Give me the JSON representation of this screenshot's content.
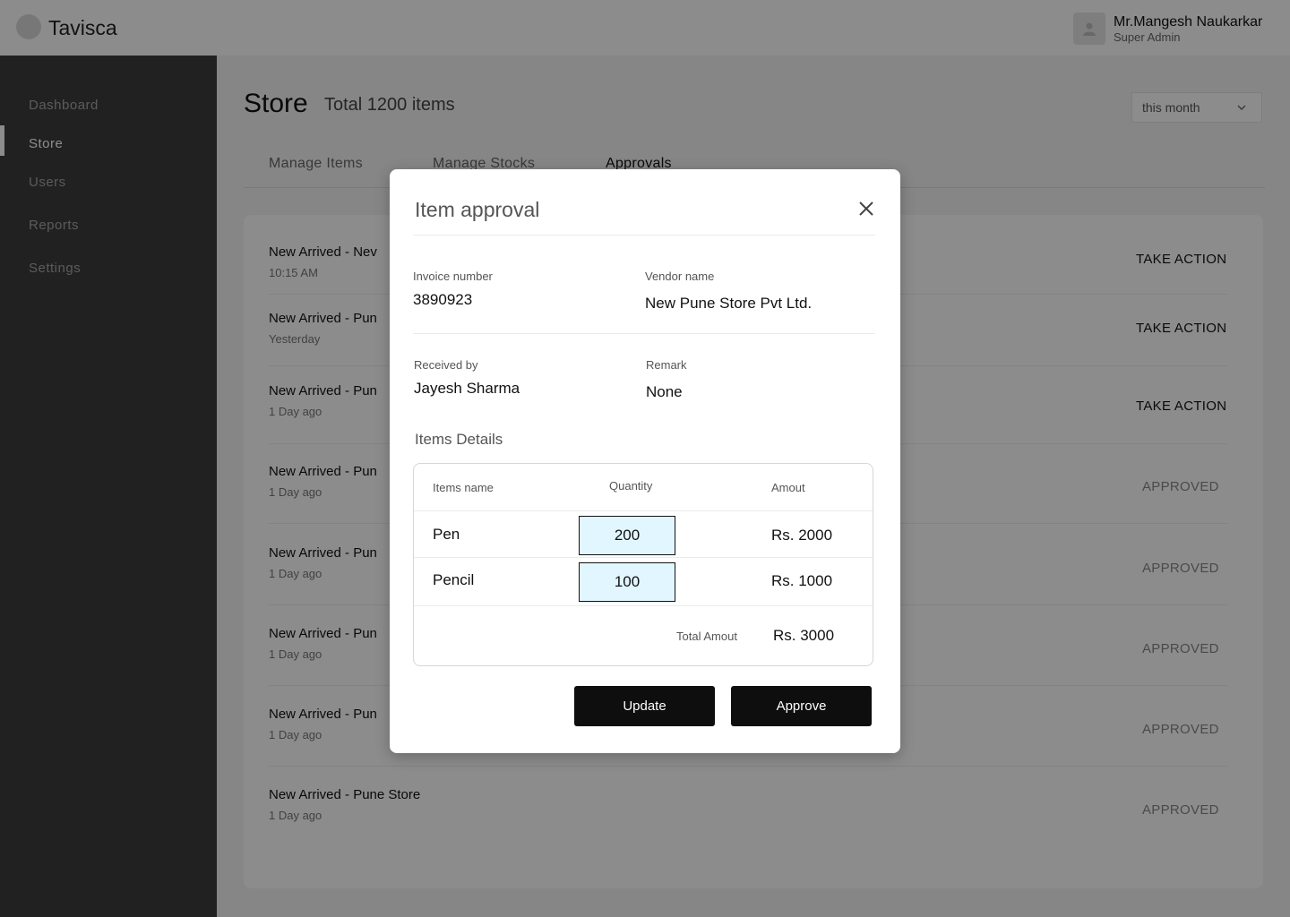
{
  "header": {
    "logo_text": "Tavisca",
    "user_name": "Mr.Mangesh Naukarkar",
    "user_role": "Super Admin"
  },
  "sidebar": {
    "items": [
      {
        "label": "Dashboard",
        "active": false
      },
      {
        "label": "Store",
        "active": true
      },
      {
        "label": "Users",
        "active": false
      },
      {
        "label": "Reports",
        "active": false
      },
      {
        "label": "Settings",
        "active": false
      }
    ]
  },
  "page": {
    "title": "Store",
    "subtitle": "Total 1200 items",
    "period_select": "this month"
  },
  "tabs": [
    {
      "label": "Manage Items",
      "active": false
    },
    {
      "label": "Manage Stocks",
      "active": false
    },
    {
      "label": "Approvals",
      "active": true
    }
  ],
  "list": [
    {
      "title": "New Arrived - Nev",
      "time": "10:15 AM",
      "action": "TAKE ACTION"
    },
    {
      "title": "New Arrived - Pun",
      "time": "Yesterday",
      "action": "TAKE ACTION"
    },
    {
      "title": "New Arrived - Pun",
      "time": "1 Day ago",
      "action": "TAKE ACTION"
    },
    {
      "title": "New Arrived - Pun",
      "time": "1 Day ago",
      "action": "APPROVED"
    },
    {
      "title": "New Arrived - Pun",
      "time": "1 Day ago",
      "action": "APPROVED"
    },
    {
      "title": "New Arrived - Pun",
      "time": "1 Day ago",
      "action": "APPROVED"
    },
    {
      "title": "New Arrived - Pun",
      "time": "1 Day ago",
      "action": "APPROVED"
    },
    {
      "title": "New Arrived - Pune Store",
      "time": "1 Day ago",
      "action": "APPROVED"
    }
  ],
  "modal": {
    "title": "Item approval",
    "invoice_label": "Invoice number",
    "invoice_value": "3890923",
    "vendor_label": "Vendor name",
    "vendor_value": "New Pune Store Pvt Ltd.",
    "received_label": "Received by",
    "received_value": "Jayesh Sharma",
    "remark_label": "Remark",
    "remark_value": "None",
    "items_section_title": "Items Details",
    "table": {
      "headers": [
        "Items name",
        "Quantity",
        "Amout"
      ],
      "rows": [
        {
          "name": "Pen",
          "quantity": "200",
          "amount": "Rs. 2000"
        },
        {
          "name": "Pencil",
          "quantity": "100",
          "amount": "Rs. 1000"
        }
      ],
      "total_label": "Total Amout",
      "total_value": "Rs. 3000"
    },
    "update_label": "Update",
    "approve_label": "Approve"
  },
  "colors": {
    "sidebar_bg": "#3d3d3d",
    "button_bg": "#0e0e0e",
    "quantity_input_bg": "#e1f6ff"
  },
  "icons": {
    "close": "close-icon",
    "dropdown": "chevron-down-icon",
    "avatar": "user-icon"
  }
}
